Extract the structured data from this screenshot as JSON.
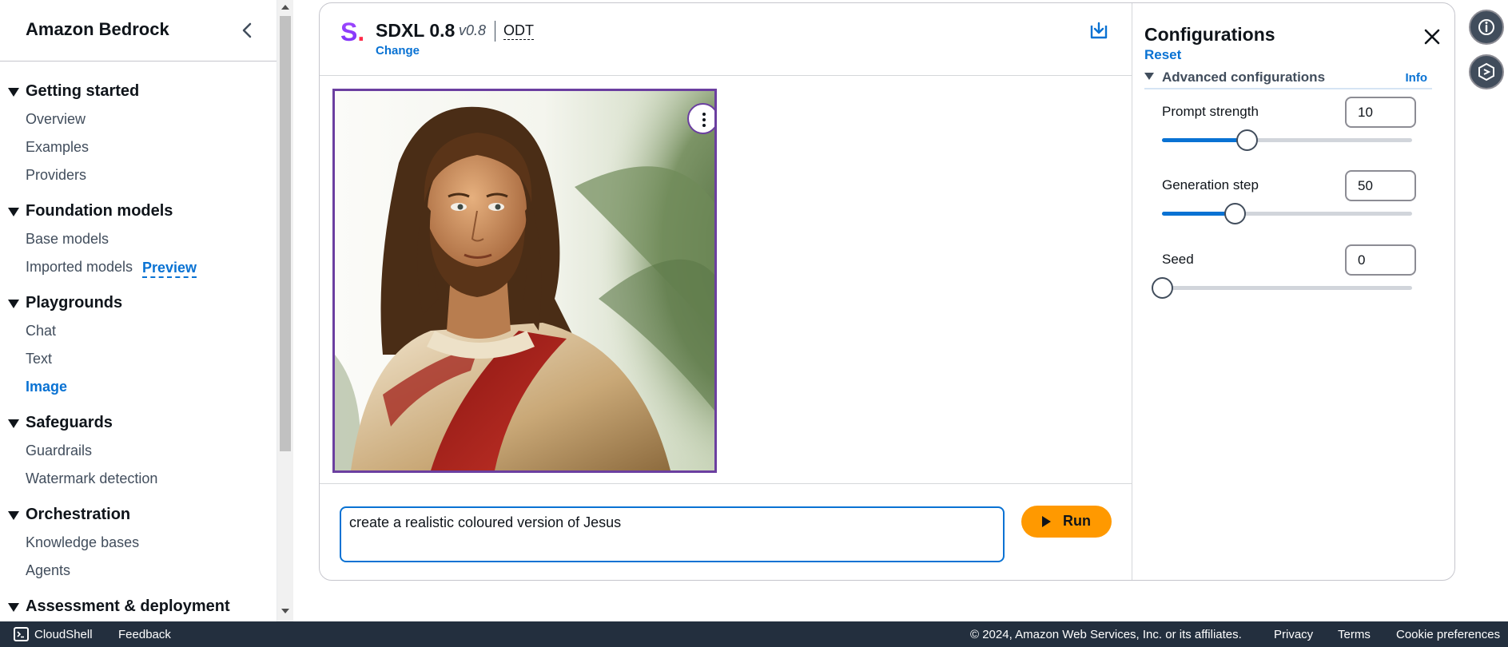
{
  "sidebar": {
    "title": "Amazon Bedrock",
    "sections": [
      {
        "label": "Getting started",
        "items": [
          "Overview",
          "Examples",
          "Providers"
        ]
      },
      {
        "label": "Foundation models",
        "items": [
          "Base models",
          "Imported models"
        ],
        "badge": "Preview"
      },
      {
        "label": "Playgrounds",
        "items": [
          "Chat",
          "Text",
          "Image"
        ],
        "active": "Image"
      },
      {
        "label": "Safeguards",
        "items": [
          "Guardrails",
          "Watermark detection"
        ]
      },
      {
        "label": "Orchestration",
        "items": [
          "Knowledge bases",
          "Agents"
        ]
      },
      {
        "label": "Assessment & deployment",
        "items": []
      }
    ]
  },
  "model": {
    "logo_letter": "S",
    "logo_dot": ".",
    "name": "SDXL 0.8",
    "version": "v0.8",
    "tag": "ODT",
    "change_label": "Change"
  },
  "prompt": {
    "value": "create a realistic coloured version of Jesus",
    "run_label": "Run"
  },
  "config": {
    "title": "Configurations",
    "reset_label": "Reset",
    "advanced_label": "Advanced configurations",
    "info_label": "Info",
    "fields": [
      {
        "label": "Prompt strength",
        "value": "10",
        "slider_fraction": 0.34
      },
      {
        "label": "Generation step",
        "value": "50",
        "slider_fraction": 0.29
      },
      {
        "label": "Seed",
        "value": "0",
        "slider_fraction": 0.0
      }
    ]
  },
  "footer": {
    "cloudshell": "CloudShell",
    "feedback": "Feedback",
    "copyright": "© 2024, Amazon Web Services, Inc. or its affiliates.",
    "privacy": "Privacy",
    "terms": "Terms",
    "cookies": "Cookie preferences"
  },
  "icons": {
    "collapse": "chevron-left-icon",
    "download": "download-icon",
    "close": "close-icon",
    "info": "info-icon",
    "rail_second": "hexagon-icon",
    "image_menu": "more-vertical-icon"
  },
  "colors": {
    "accent": "#0972d3",
    "run_button": "#ff9900",
    "image_border": "#6b3fa0",
    "footer_bg": "#232f3e"
  }
}
